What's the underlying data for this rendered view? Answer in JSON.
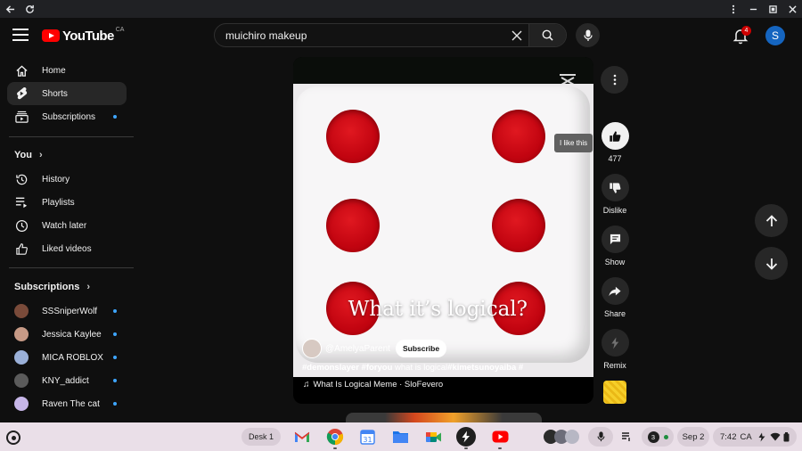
{
  "browser": {
    "back_icon": "back-arrow-icon",
    "reload_icon": "reload-icon",
    "menu_icon": "kebab-icon",
    "minimize_icon": "minimize-icon",
    "maximize_icon": "maximize-icon",
    "close_icon": "close-icon"
  },
  "header": {
    "logo_text": "YouTube",
    "logo_region": "CA",
    "search_value": "muichiro makeup",
    "notification_count": "4",
    "avatar_letter": "S"
  },
  "sidebar": {
    "main": [
      {
        "label": "Home",
        "icon": "home-icon"
      },
      {
        "label": "Shorts",
        "icon": "shorts-icon",
        "active": true
      },
      {
        "label": "Subscriptions",
        "icon": "subscriptions-icon",
        "dot": true
      }
    ],
    "you_heading": "You",
    "you": [
      {
        "label": "History",
        "icon": "history-icon"
      },
      {
        "label": "Playlists",
        "icon": "playlists-icon"
      },
      {
        "label": "Watch later",
        "icon": "watch-later-icon"
      },
      {
        "label": "Liked videos",
        "icon": "thumbs-up-icon"
      }
    ],
    "subs_heading": "Subscriptions",
    "subs": [
      {
        "label": "SSSniperWolf",
        "color": "#7a4b3a"
      },
      {
        "label": "Jessica Kaylee",
        "color": "#c79a86"
      },
      {
        "label": "MICA ROBLOX",
        "color": "#9ab0d8"
      },
      {
        "label": "KNY_addict",
        "color": "#5b5b5b"
      },
      {
        "label": "Raven The cat",
        "color": "#c7b6e8"
      }
    ]
  },
  "short": {
    "overlay_text": "What it’s logical?",
    "channel": "@AmelyaParent",
    "subscribe_label": "Subscribe",
    "caption_tags_1": "#demonslayer #foryou",
    "caption_text": " what is logical",
    "caption_tags_2": "#kimetsunoyaiba #",
    "music": "What Is Logical Meme · SloFevero"
  },
  "actions": {
    "tooltip": "I like this",
    "likes": "477",
    "dislike": "Dislike",
    "comments": "Show",
    "share": "Share",
    "remix": "Remix"
  },
  "shelf": {
    "desk_label": "Desk 1",
    "apps": [
      "gmail-icon",
      "chrome-icon",
      "calendar-icon",
      "files-icon",
      "meet-icon",
      "app-icon",
      "youtube-icon"
    ],
    "notif_count": "3",
    "date": "Sep 2",
    "time": "7:42",
    "region": "CA"
  }
}
